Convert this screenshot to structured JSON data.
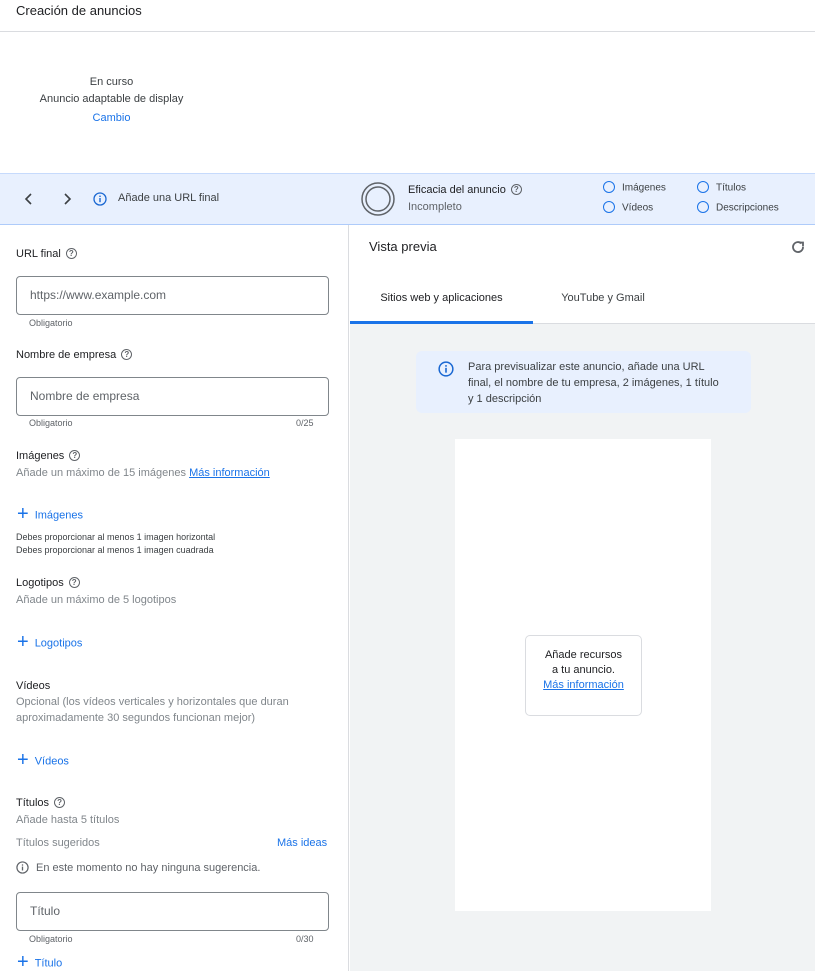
{
  "header": {
    "title": "Creación de anuncios"
  },
  "status": {
    "state": "En curso",
    "ad_type": "Anuncio adaptable de display",
    "change_link": "Cambio"
  },
  "toolbar": {
    "prev_icon": "chevron-left-icon",
    "next_icon": "chevron-right-icon",
    "hint": "Añade una URL final",
    "efficacy_title": "Eficacia del anuncio",
    "efficacy_status": "Incompleto",
    "checklist": [
      "Imágenes",
      "Títulos",
      "Vídeos",
      "Descripciones"
    ]
  },
  "form": {
    "url_label": "URL final",
    "url_placeholder": "https://www.example.com",
    "url_required": "Obligatorio",
    "business_label": "Nombre de empresa",
    "business_placeholder": "Nombre de empresa",
    "business_required": "Obligatorio",
    "business_count": "0/25",
    "images_label": "Imágenes",
    "images_sub": "Añade un máximo de 15 imágenes",
    "images_more": "Más información",
    "images_add": "Imágenes",
    "images_req1": "Debes proporcionar al menos 1 imagen horizontal",
    "images_req2": "Debes proporcionar al menos 1 imagen cuadrada",
    "logos_label": "Logotipos",
    "logos_sub": "Añade un máximo de 5 logotipos",
    "logos_add": "Logotipos",
    "videos_label": "Vídeos",
    "videos_sub1": "Opcional (los vídeos verticales y horizontales que duran",
    "videos_sub2": "aproximadamente 30 segundos funcionan mejor)",
    "videos_add": "Vídeos",
    "titles_label": "Títulos",
    "titles_sub": "Añade hasta 5 títulos",
    "titles_suggested": "Títulos sugeridos",
    "titles_more_ideas": "Más ideas",
    "titles_no_suggestion": "En este momento no hay ninguna sugerencia.",
    "title_placeholder": "Título",
    "title_required": "Obligatorio",
    "title_count": "0/30",
    "title_add": "Título"
  },
  "preview": {
    "title": "Vista previa",
    "tabs": [
      "Sitios web y aplicaciones",
      "YouTube y Gmail"
    ],
    "info_line1": "Para previsualizar este anuncio, añade una URL",
    "info_line2": "final, el nombre de tu empresa, 2 imágenes, 1 título",
    "info_line3": "y 1 descripción",
    "card_line1": "Añade recursos",
    "card_line2": "a tu anuncio.",
    "card_link": "Más información"
  },
  "colors": {
    "accent": "#1a73e8",
    "toolbar_bg": "#e8f0fe",
    "preview_bg": "#f1f3f4"
  }
}
